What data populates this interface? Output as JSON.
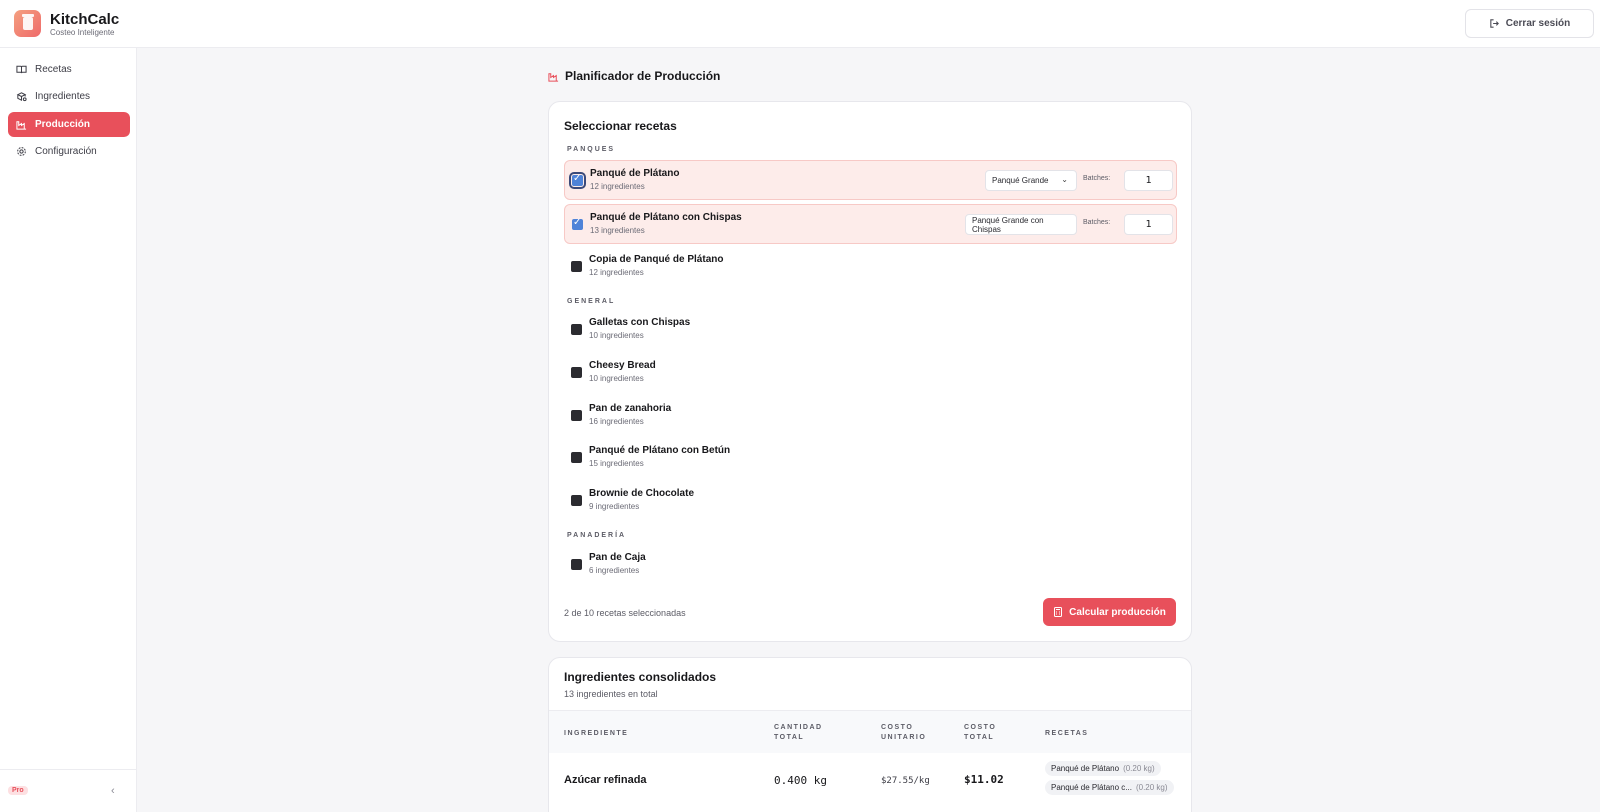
{
  "app": {
    "name": "KitchCalc",
    "subtitle": "Costeo Inteligente",
    "logout_label": "Cerrar sesión"
  },
  "sidebar": {
    "items": [
      {
        "label": "Recetas",
        "icon": "book-icon",
        "active": false
      },
      {
        "label": "Ingredientes",
        "icon": "ingredients-icon",
        "active": false
      },
      {
        "label": "Producción",
        "icon": "factory-icon",
        "active": true
      },
      {
        "label": "Configuración",
        "icon": "gear-icon",
        "active": false
      }
    ],
    "badge": "Pro"
  },
  "page": {
    "title": "Planificador de Producción"
  },
  "selector": {
    "title": "Seleccionar recetas",
    "batches_label": "Batches:",
    "groups": [
      {
        "label": "PANQUES",
        "recipes": [
          {
            "name": "Panqué de Plátano",
            "sub": "12 ingredientes",
            "checked": true,
            "size": "Panqué Grande",
            "batches": "1"
          },
          {
            "name": "Panqué de Plátano con Chispas",
            "sub": "13 ingredientes",
            "checked": true,
            "size": "Panqué Grande con Chispas",
            "batches": "1"
          },
          {
            "name": "Copia de Panqué de Plátano",
            "sub": "12 ingredientes",
            "checked": false
          }
        ]
      },
      {
        "label": "GENERAL",
        "recipes": [
          {
            "name": "Galletas con Chispas",
            "sub": "10 ingredientes",
            "checked": false
          },
          {
            "name": "Cheesy Bread",
            "sub": "10 ingredientes",
            "checked": false
          },
          {
            "name": "Pan de zanahoria",
            "sub": "16 ingredientes",
            "checked": false
          },
          {
            "name": "Panqué de Plátano con Betún",
            "sub": "15 ingredientes",
            "checked": false
          },
          {
            "name": "Brownie de Chocolate",
            "sub": "9 ingredientes",
            "checked": false
          }
        ]
      },
      {
        "label": "PANADERÍA",
        "recipes": [
          {
            "name": "Pan de Caja",
            "sub": "6 ingredientes",
            "checked": false
          }
        ]
      }
    ],
    "selected_count": "2 de 10 recetas seleccionadas",
    "calc_label": "Calcular producción"
  },
  "consolidated": {
    "title": "Ingredientes consolidados",
    "subtitle": "13 ingredientes en total",
    "headers": {
      "ingrediente": "INGREDIENTE",
      "cantidad_1": "CANTIDAD",
      "cantidad_2": "TOTAL",
      "unitario_1": "COSTO",
      "unitario_2": "UNITARIO",
      "total_1": "COSTO",
      "total_2": "TOTAL",
      "recetas": "RECETAS"
    },
    "rows": [
      {
        "name": "Azúcar refinada",
        "qty": "0.400 kg",
        "unit_cost": "$27.55/kg",
        "total_cost": "$11.02",
        "recipes": [
          {
            "name": "Panqué de Plátano",
            "amount": "(0.20 kg)"
          },
          {
            "name": "Panqué de Plátano c...",
            "amount": "(0.20 kg)"
          }
        ]
      }
    ]
  },
  "colors": {
    "accent": "#e8505b",
    "checkbox": "#4f83d8",
    "selected_row_bg": "#fdecea"
  }
}
